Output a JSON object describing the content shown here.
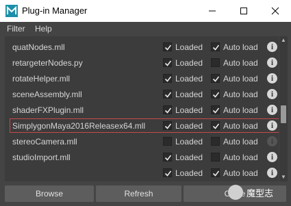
{
  "window": {
    "title": "Plug-in Manager"
  },
  "menubar": {
    "items": [
      "Filter",
      "Help"
    ]
  },
  "plugins": [
    {
      "name": "quatNodes.mll",
      "loaded": true,
      "autoload": true,
      "info_enabled": true
    },
    {
      "name": "retargeterNodes.py",
      "loaded": true,
      "autoload": false,
      "info_enabled": true
    },
    {
      "name": "rotateHelper.mll",
      "loaded": true,
      "autoload": true,
      "info_enabled": true
    },
    {
      "name": "sceneAssembly.mll",
      "loaded": true,
      "autoload": true,
      "info_enabled": true
    },
    {
      "name": "shaderFXPlugin.mll",
      "loaded": true,
      "autoload": true,
      "info_enabled": true
    },
    {
      "name": "SimplygonMaya2016Releasex64.mll",
      "loaded": true,
      "autoload": true,
      "info_enabled": true,
      "selected": true
    },
    {
      "name": "stereoCamera.mll",
      "loaded": false,
      "autoload": false,
      "info_enabled": false
    },
    {
      "name": "studioImport.mll",
      "loaded": true,
      "autoload": false,
      "info_enabled": true
    },
    {
      "name": "",
      "loaded": true,
      "autoload": true,
      "info_enabled": true
    }
  ],
  "labels": {
    "loaded": "Loaded",
    "autoload": "Auto load",
    "info": "i"
  },
  "buttons": {
    "browse": "Browse",
    "refresh": "Refresh",
    "close": "Close"
  },
  "watermark": {
    "text": "魔型志"
  },
  "colors": {
    "selection_border": "#c94a4a",
    "panel_bg": "#3c3c3c",
    "window_bg": "#444444"
  }
}
